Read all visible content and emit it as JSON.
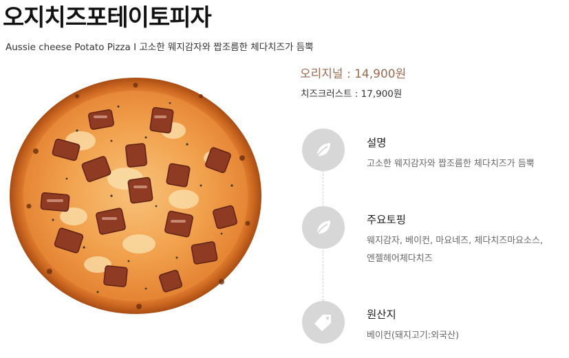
{
  "product": {
    "name": "오지치즈포테이토피자",
    "subtitle": "Aussie cheese Potato Pizza I 고소한 웨지감자와 짭조름한 체다치즈가 듬뿍",
    "image_icon": "pizza-photo"
  },
  "prices": {
    "original": "오리지널 : 14,900원",
    "cheese_crust": "치즈크러스트 : 17,900원"
  },
  "info": [
    {
      "icon": "leaf-icon",
      "heading": "설명",
      "lines": [
        "고소한 웨지감자와 짭조름한 체다치즈가 듬뿍"
      ]
    },
    {
      "icon": "leaf-icon",
      "heading": "주요토핑",
      "lines": [
        "웨지감자, 베이컨, 마요네즈, 체다치즈마요소스,",
        "엔젤헤어체다치즈"
      ]
    },
    {
      "icon": "tag-icon",
      "heading": "원산지",
      "lines": [
        "베이컨(돼지고기:외국산)"
      ]
    }
  ],
  "colors": {
    "price_accent": "#9c6a4f",
    "icon_circle": "#d7d7d7",
    "crust": "#c8621d",
    "cheese": "#f3a04a"
  }
}
